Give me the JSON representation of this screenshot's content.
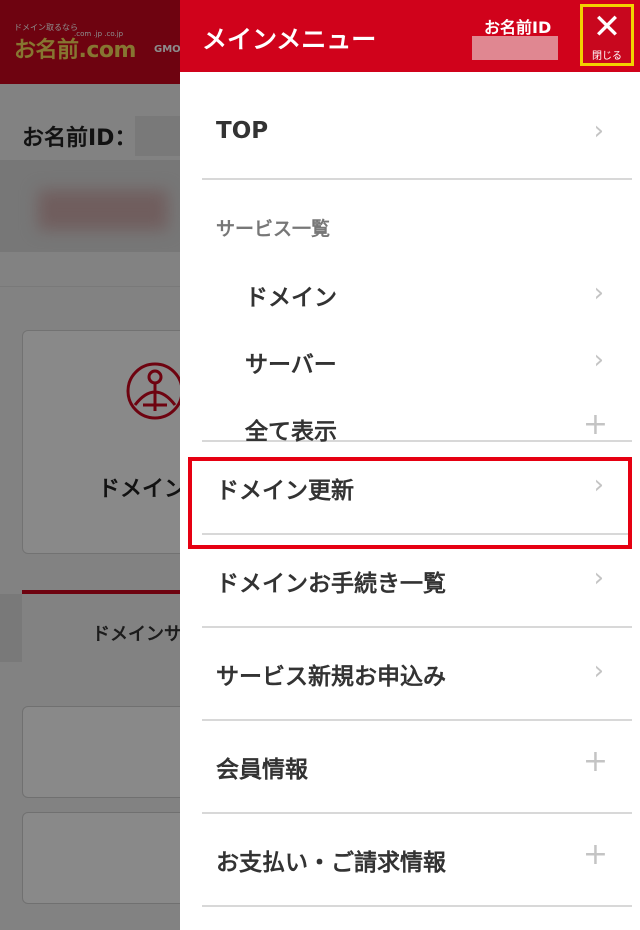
{
  "background": {
    "logo": {
      "tagline": "ドメイン取るなら",
      "text": "お名前.com",
      "tlds": ".com .jp .co.jp",
      "brand": "GMO"
    },
    "id_label": "お名前ID：",
    "card_label": "ドメイン",
    "tab_label": "ドメインサ"
  },
  "menu_panel": {
    "title": "メインメニュー",
    "id_label": "お名前ID",
    "close_label": "閉じる",
    "items": {
      "top": "TOP",
      "services_heading": "サービス一覧",
      "domain": "ドメイン",
      "server": "サーバー",
      "show_all": "全て表示",
      "domain_renewal": "ドメイン更新",
      "domain_procedures": "ドメインお手続き一覧",
      "new_service": "サービス新規お申込み",
      "member_info": "会員情報",
      "payment_info": "お支払い・ご請求情報"
    }
  },
  "colors": {
    "brand_red": "#d0021b",
    "highlight": "#e60012",
    "close_border": "#f2d200"
  },
  "icons": {
    "chevron": "›",
    "plus": "+",
    "close": "✕"
  }
}
